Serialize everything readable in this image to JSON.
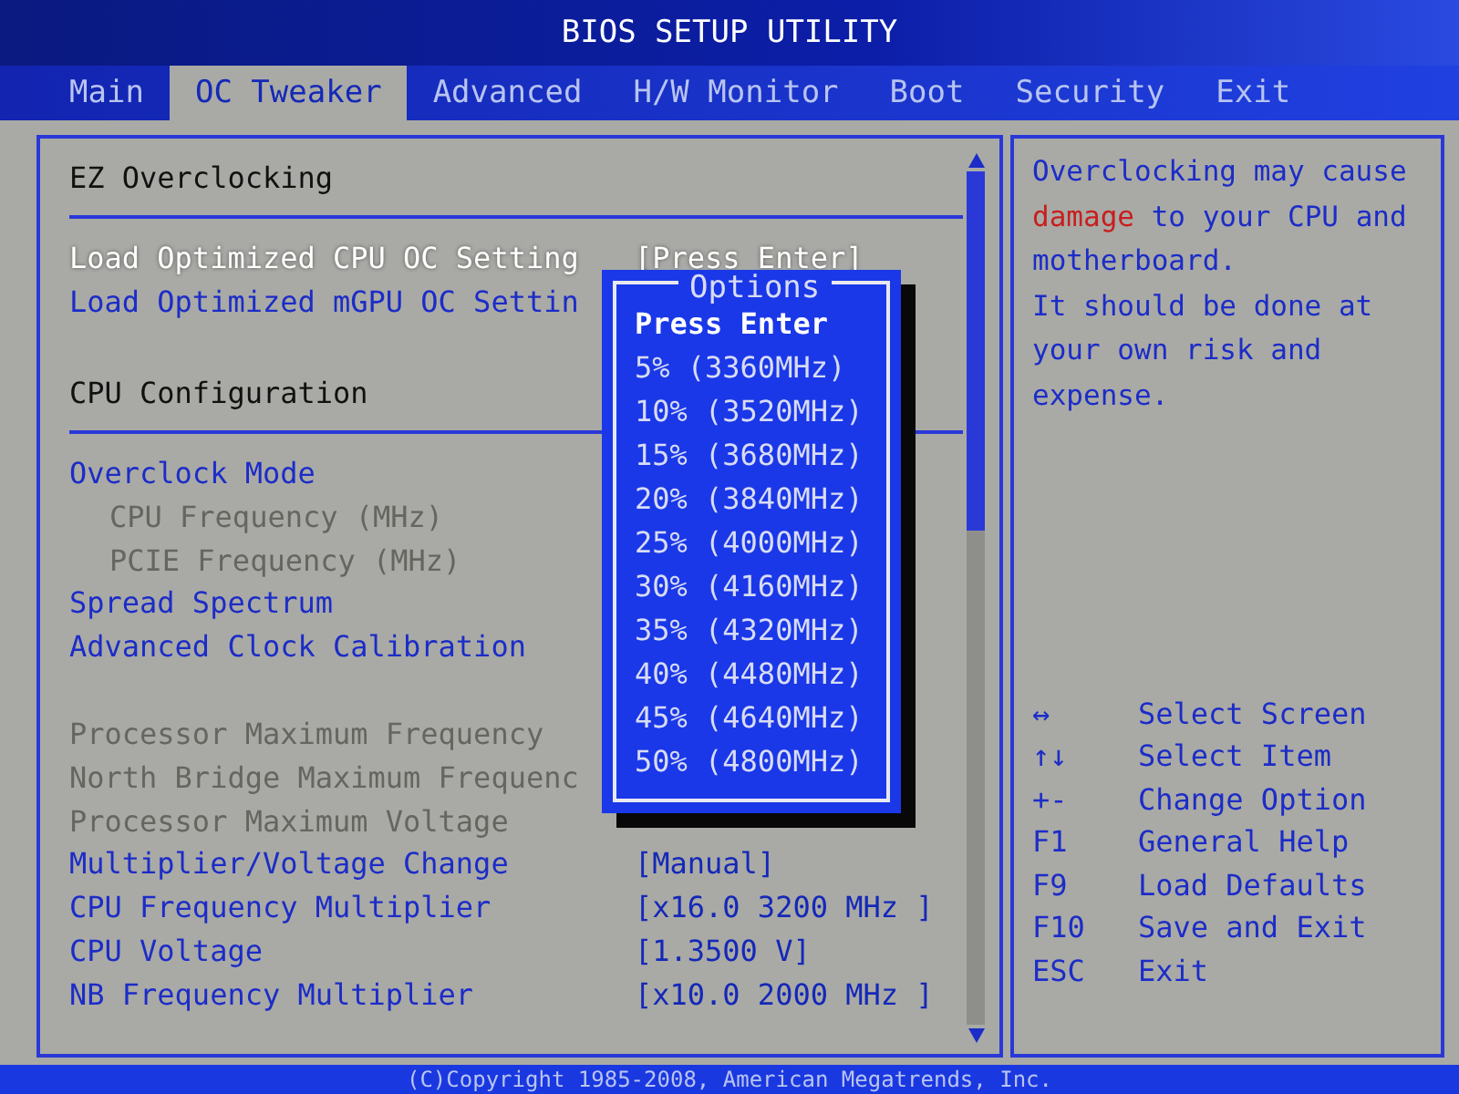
{
  "window": {
    "title": "BIOS SETUP UTILITY"
  },
  "tabs": [
    {
      "label": "Main",
      "selected": false
    },
    {
      "label": "OC Tweaker",
      "selected": true
    },
    {
      "label": "Advanced",
      "selected": false
    },
    {
      "label": "H/W Monitor",
      "selected": false
    },
    {
      "label": "Boot",
      "selected": false
    },
    {
      "label": "Security",
      "selected": false
    },
    {
      "label": "Exit",
      "selected": false
    }
  ],
  "sections": [
    {
      "title": "EZ Overclocking",
      "items": [
        {
          "label": "Load Optimized CPU OC Setting",
          "value": "[Press Enter]",
          "selected": true,
          "disabled": false
        },
        {
          "label": "Load Optimized mGPU OC Settin",
          "selected": false,
          "disabled": false
        }
      ]
    },
    {
      "title": "CPU Configuration",
      "items": [
        {
          "label": "Overclock Mode",
          "selected": false,
          "disabled": false,
          "children": [
            {
              "label": "CPU Frequency (MHz)",
              "selected": false,
              "disabled": true
            },
            {
              "label": "PCIE Frequency (MHz)",
              "selected": false,
              "disabled": true
            }
          ]
        },
        {
          "label": "Spread Spectrum",
          "selected": false,
          "disabled": false
        },
        {
          "label": "Advanced Clock Calibration",
          "selected": false,
          "disabled": false
        },
        {
          "kind": "gap"
        },
        {
          "label": "Processor Maximum Frequency",
          "selected": false,
          "disabled": true
        },
        {
          "label": "North Bridge Maximum Frequenc",
          "selected": false,
          "disabled": true
        },
        {
          "label": "Processor Maximum Voltage",
          "selected": false,
          "disabled": true
        },
        {
          "label": "Multiplier/Voltage Change",
          "value": "[Manual]",
          "selected": false,
          "disabled": false
        },
        {
          "label": "CPU Frequency Multiplier",
          "value": "[x16.0 3200 MHz ]",
          "selected": false,
          "disabled": false
        },
        {
          "label": "CPU Voltage",
          "value": "[1.3500 V]",
          "selected": false,
          "disabled": false
        },
        {
          "label": "NB Frequency Multiplier",
          "value": "[x10.0 2000 MHz ]",
          "selected": false,
          "disabled": false
        }
      ]
    }
  ],
  "popup": {
    "title": "Options",
    "options": [
      {
        "label": "Press Enter",
        "selected": true
      },
      {
        "label": "5% (3360MHz)",
        "selected": false
      },
      {
        "label": "10% (3520MHz)",
        "selected": false
      },
      {
        "label": "15% (3680MHz)",
        "selected": false
      },
      {
        "label": "20% (3840MHz)",
        "selected": false
      },
      {
        "label": "25% (4000MHz)",
        "selected": false
      },
      {
        "label": "30% (4160MHz)",
        "selected": false
      },
      {
        "label": "35% (4320MHz)",
        "selected": false
      },
      {
        "label": "40% (4480MHz)",
        "selected": false
      },
      {
        "label": "45% (4640MHz)",
        "selected": false
      },
      {
        "label": "50% (4800MHz)",
        "selected": false
      }
    ]
  },
  "help": [
    {
      "text": "Overclocking may cause ",
      "kind": "normal"
    },
    {
      "text": "damage",
      "kind": "warning"
    },
    {
      "text": " to your CPU and motherboard.",
      "kind": "normal"
    },
    {
      "text": "\nIt should be done at your own risk and expense.",
      "kind": "normal"
    }
  ],
  "keys": [
    {
      "key": "↔",
      "action": "Select Screen"
    },
    {
      "key": "↑↓",
      "action": "Select Item"
    },
    {
      "key": "+-",
      "action": "Change Option"
    },
    {
      "key": "F1",
      "action": "General Help"
    },
    {
      "key": "F9",
      "action": "Load Defaults"
    },
    {
      "key": "F10",
      "action": "Save and Exit"
    },
    {
      "key": "ESC",
      "action": "Exit"
    }
  ],
  "footer": "(C)Copyright 1985-2008, American Megatrends, Inc."
}
